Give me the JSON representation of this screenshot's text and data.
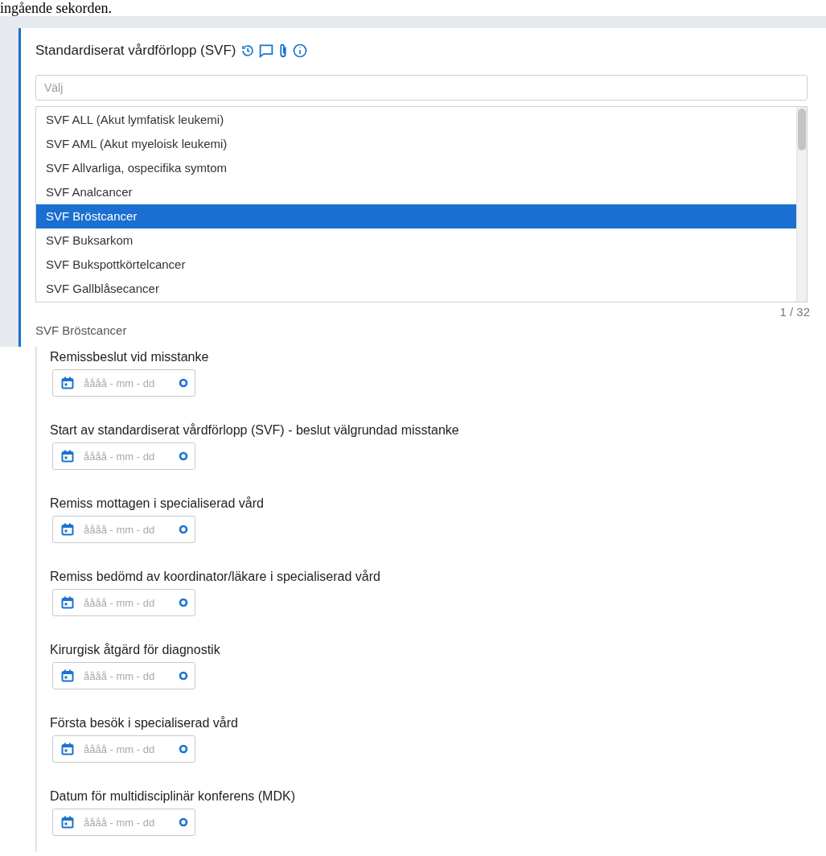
{
  "intro_text": "ingående sekorden.",
  "section": {
    "title": "Standardiserat vårdförlopp (SVF)",
    "search": {
      "placeholder": "Välj"
    },
    "options": [
      {
        "label": "SVF ALL (Akut lymfatisk leukemi)",
        "selected": false
      },
      {
        "label": "SVF AML (Akut myeloisk leukemi)",
        "selected": false
      },
      {
        "label": "SVF Allvarliga, ospecifika symtom",
        "selected": false
      },
      {
        "label": "SVF Analcancer",
        "selected": false
      },
      {
        "label": "SVF Bröstcancer",
        "selected": true
      },
      {
        "label": "SVF Buksarkom",
        "selected": false
      },
      {
        "label": "SVF Bukspottkörtelcancer",
        "selected": false
      },
      {
        "label": "SVF Gallblåsecancer",
        "selected": false
      }
    ],
    "counter": "1 / 32",
    "selected_value": "SVF Bröstcancer"
  },
  "date_fields": [
    {
      "label": "Remissbeslut vid misstanke",
      "placeholder": "åååå - mm - dd"
    },
    {
      "label": "Start av standardiserat vårdförlopp (SVF) - beslut välgrundad misstanke",
      "placeholder": "åååå - mm - dd"
    },
    {
      "label": "Remiss mottagen i specialiserad vård",
      "placeholder": "åååå - mm - dd"
    },
    {
      "label": "Remiss bedömd av koordinator/läkare i specialiserad vård",
      "placeholder": "åååå - mm - dd"
    },
    {
      "label": "Kirurgisk åtgärd för diagnostik",
      "placeholder": "åååå - mm - dd"
    },
    {
      "label": "Första besök i specialiserad vård",
      "placeholder": "åååå - mm - dd"
    },
    {
      "label": "Datum för multidisciplinär konferens (MDK)",
      "placeholder": "åååå - mm - dd"
    }
  ]
}
